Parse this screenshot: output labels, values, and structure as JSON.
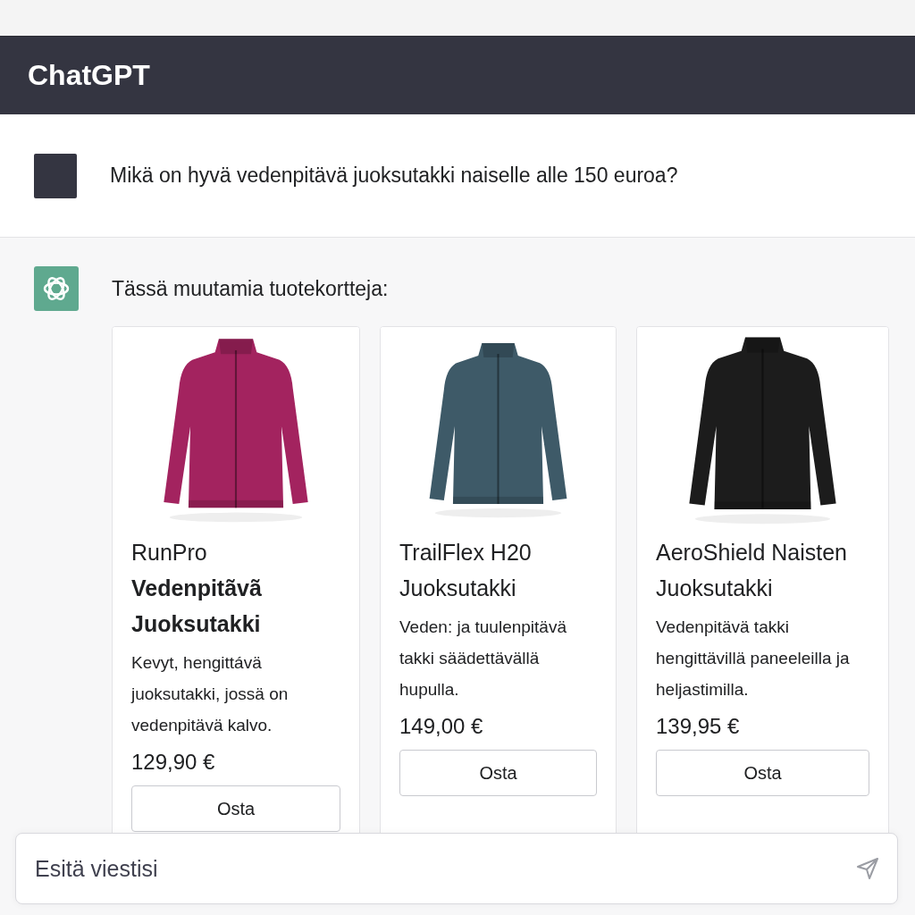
{
  "header": {
    "title": "ChatGPT"
  },
  "messages": [
    {
      "kind": "user",
      "text": "Mikä on hyvä vedenpitävä juoksutakki naiselle alle 150 euroa?"
    },
    {
      "kind": "assistant",
      "text": "Tässä muutamia tuotekortteja:",
      "products": [
        {
          "title": "RunPro **Vedenpitãvã Juoksutakki**",
          "description": "Kevyt, hengittávä juoksutakki, jossä on vedenpitävä kalvo.",
          "price": "129,90 €",
          "button": "Osta"
        },
        {
          "title": "TrailFlex H20 Juoksutakki",
          "description": "Veden: ja tuulenpitävä takki säädettävällä hupulla.",
          "price": "149,00 €",
          "button": "Osta"
        },
        {
          "title": "AeroShield Naisten Juoksutakki",
          "description": "Vedenpitävä takki hengittävillä paneeleilla ja heljastimilla.",
          "price": "139,95 €",
          "button": "Osta"
        }
      ]
    }
  ],
  "composer": {
    "placeholder": "Esitä viestisi"
  }
}
